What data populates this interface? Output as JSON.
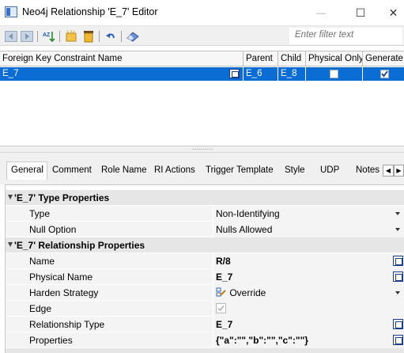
{
  "window": {
    "title": "Neo4j Relationship 'E_7' Editor",
    "min_glyph": "—",
    "max_glyph": "☐",
    "close_glyph": "✕"
  },
  "toolbar": {
    "filter_placeholder": "Enter filter text",
    "icons": [
      "prev-icon",
      "next-icon",
      "sort-icon",
      "new-icon",
      "delete-icon",
      "undo-icon",
      "erase-icon"
    ]
  },
  "grid": {
    "headers": [
      "Foreign Key Constraint Name",
      "Parent",
      "Child",
      "Physical Only",
      "Generate"
    ],
    "rows": [
      {
        "name": "E_7",
        "parent": "E_6",
        "child": "E_8",
        "physical_only": false,
        "generate": true
      }
    ]
  },
  "tabs": [
    "General",
    "Comment",
    "Role Name",
    "RI Actions",
    "Trigger Template",
    "Style",
    "UDP",
    "Notes"
  ],
  "properties": {
    "group1": "'E_7' Type Properties",
    "type_label": "Type",
    "type_value": "Non-Identifying",
    "null_label": "Null Option",
    "null_value": "Nulls Allowed",
    "group2": "'E_7' Relationship Properties",
    "name_label": "Name",
    "name_value": "R/8",
    "physname_label": "Physical Name",
    "physname_value": "E_7",
    "harden_label": "Harden Strategy",
    "harden_value": "Override",
    "edge_label": "Edge",
    "edge_checked": true,
    "reltype_label": "Relationship Type",
    "reltype_value": "E_7",
    "props_label": "Properties",
    "props_value": "{\"a\":\"\",\"b\":\"\",\"c\":\"\"}"
  },
  "colors": {
    "selection": "#0b6dd4",
    "group_bg": "#e6e6e6",
    "row_bg": "#f4f4f4"
  }
}
